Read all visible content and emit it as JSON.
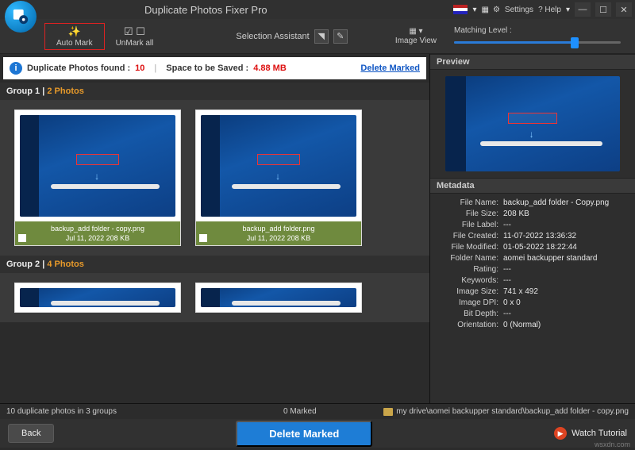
{
  "titlebar": {
    "app_title": "Duplicate Photos Fixer Pro",
    "settings_label": "Settings",
    "help_label": "? Help",
    "lang_dropdown_icon": "▾"
  },
  "toolbar": {
    "auto_mark": "Auto Mark",
    "unmark_all": "UnMark all",
    "selection_assistant": "Selection Assistant",
    "image_view": "Image View",
    "matching_level": "Matching Level :"
  },
  "infobar": {
    "found_label": "Duplicate Photos found :",
    "found_value": "10",
    "space_label": "Space to be Saved :",
    "space_value": "4.88 MB",
    "delete_marked": "Delete Marked"
  },
  "groups": [
    {
      "header_prefix": "Group 1",
      "header_count": "2 Photos",
      "photos": [
        {
          "filename": "backup_add folder - copy.png",
          "meta": "Jul 11, 2022   208 KB"
        },
        {
          "filename": "backup_add folder.png",
          "meta": "Jul 11, 2022   208 KB"
        }
      ]
    },
    {
      "header_prefix": "Group 2",
      "header_count": "4 Photos"
    }
  ],
  "rightpane": {
    "preview_label": "Preview",
    "metadata_label": "Metadata",
    "metadata": [
      {
        "k": "File Name:",
        "v": "backup_add folder - Copy.png"
      },
      {
        "k": "File Size:",
        "v": "208 KB"
      },
      {
        "k": "File Label:",
        "v": "---"
      },
      {
        "k": "File Created:",
        "v": "11-07-2022 13:36:32"
      },
      {
        "k": "File Modified:",
        "v": "01-05-2022 18:22:44"
      },
      {
        "k": "Folder Name:",
        "v": "aomei backupper standard"
      },
      {
        "k": "Rating:",
        "v": "---"
      },
      {
        "k": "Keywords:",
        "v": "---"
      },
      {
        "k": "Image Size:",
        "v": "741 x 492"
      },
      {
        "k": "Image DPI:",
        "v": "0 x 0"
      },
      {
        "k": "Bit Depth:",
        "v": "---"
      },
      {
        "k": "Orientation:",
        "v": "0 (Normal)"
      }
    ]
  },
  "statusbar": {
    "summary": "10 duplicate photos in 3 groups",
    "marked": "0 Marked",
    "path": "my drive\\aomei backupper standard\\backup_add folder - copy.png"
  },
  "bottom": {
    "back": "Back",
    "delete_marked": "Delete Marked",
    "watch_tutorial": "Watch Tutorial"
  },
  "watermark": "wsxdn.com"
}
